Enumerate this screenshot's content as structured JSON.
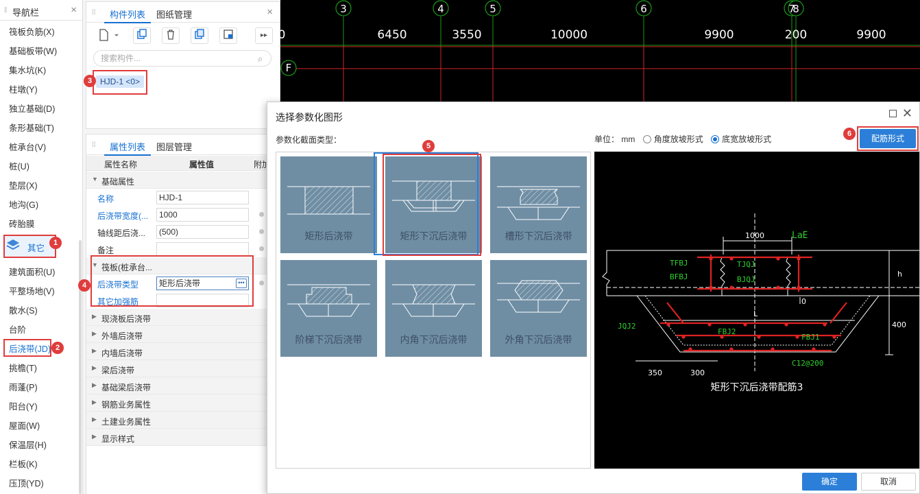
{
  "nav": {
    "title": "导航栏",
    "items": [
      "筏板负筋(X)",
      "基础板带(W)",
      "集水坑(K)",
      "柱墩(Y)",
      "独立基础(D)",
      "条形基础(T)",
      "桩承台(V)",
      "桩(U)",
      "垫层(X)",
      "地沟(G)",
      "砖胎膜",
      "其它",
      "建筑面积(U)",
      "平整场地(V)",
      "散水(S)",
      "台阶",
      "后浇带(JD)",
      "挑檐(T)",
      "雨蓬(P)",
      "阳台(Y)",
      "屋面(W)",
      "保温层(H)",
      "栏板(K)",
      "压顶(YD)"
    ],
    "badge_other": "1",
    "badge_post": "2"
  },
  "component_panel": {
    "tab_list": "构件列表",
    "tab_drawings": "图纸管理",
    "search_placeholder": "搜索构件...",
    "item": "HJD-1 <0>",
    "badge": "3"
  },
  "property_panel": {
    "tab_props": "属性列表",
    "tab_layers": "图层管理",
    "col_name": "属性名称",
    "col_value": "属性值",
    "col_extra": "附加",
    "group_basic": "基础属性",
    "rows": [
      {
        "k": "名称",
        "v": "HJD-1"
      },
      {
        "k": "后浇带宽度(...",
        "v": "1000"
      },
      {
        "k": "轴线距后浇...",
        "v": "(500)"
      },
      {
        "k": "备注",
        "v": ""
      }
    ],
    "group_raft": "筏板(桩承台...",
    "raft_rows": [
      {
        "k": "后浇带类型",
        "v": "矩形后浇带"
      },
      {
        "k": "其它加强筋",
        "v": ""
      }
    ],
    "badge": "4",
    "collapsed": [
      "现浇板后浇带",
      "外墙后浇带",
      "内墙后浇带",
      "梁后浇带",
      "基础梁后浇带",
      "钢筋业务属性",
      "土建业务属性",
      "显示样式"
    ]
  },
  "cad": {
    "axes": [
      "3",
      "4",
      "5",
      "6",
      "7",
      "8"
    ],
    "axis_row": "F",
    "dims": [
      "0",
      "6450",
      "3550",
      "10000",
      "9900",
      "200",
      "9900"
    ]
  },
  "dialog": {
    "title": "选择参数化图形",
    "section_label": "参数化截面类型：",
    "unit_label": "单位：",
    "unit_value": "mm",
    "radio1": "角度放坡形式",
    "radio2": "底宽放坡形式",
    "rebar_button": "配筋形式",
    "badge_shape": "5",
    "badge_rebar": "6",
    "shapes": [
      "矩形后浇带",
      "矩形下沉后浇带",
      "槽形下沉后浇带",
      "阶梯下沉后浇带",
      "内角下沉后浇带",
      "外角下沉后浇带"
    ],
    "preview": {
      "dim_top": "1000",
      "lae": "LaE",
      "tfbj": "TFBJ",
      "bfbj": "BFBJ",
      "tjqj": "TJQJ",
      "bjqj": "BJQJ",
      "h": "h",
      "zero": "0",
      "l": "L",
      "jqj2": "JQJ2",
      "fbj2": "FBJ2",
      "fbj1": "FBJ1",
      "c12": "C12@200",
      "d400": "400",
      "d350": "350",
      "d300": "300",
      "caption": "矩形下沉后浇带配筋3"
    },
    "ok": "确定",
    "cancel": "取消"
  }
}
